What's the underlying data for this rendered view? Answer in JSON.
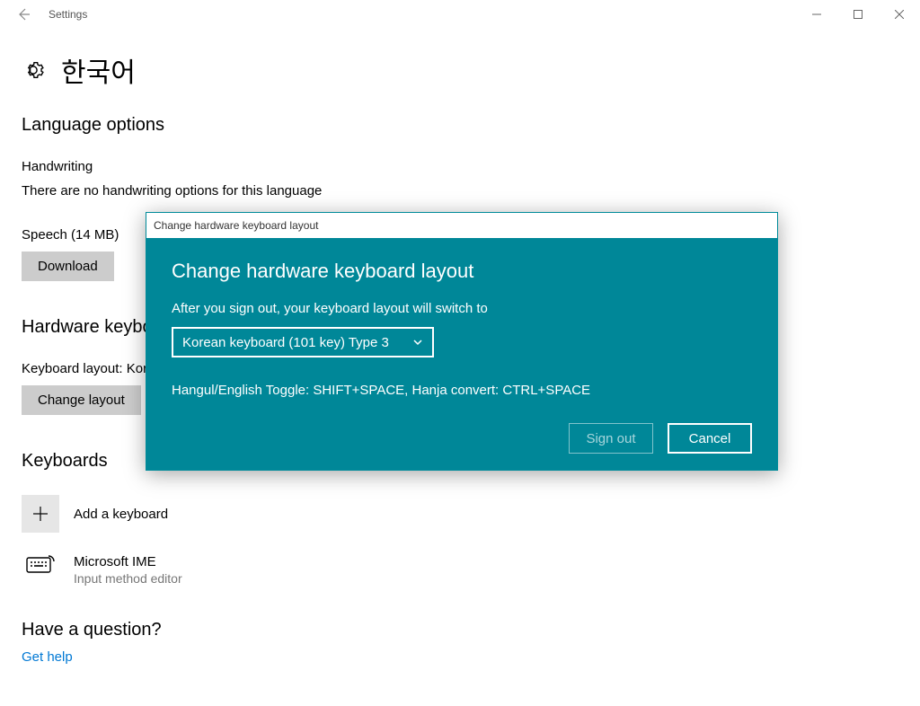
{
  "window": {
    "title": "Settings"
  },
  "header": {
    "page_title": "한국어"
  },
  "sections": {
    "language_options_title": "Language options",
    "handwriting_label": "Handwriting",
    "handwriting_msg": "There are no handwriting options for this language",
    "speech_label": "Speech (14 MB)",
    "download_label": "Download",
    "hardware_title": "Hardware keyboard layout",
    "layout_label": "Keyboard layout:  Korean",
    "change_layout_label": "Change layout",
    "keyboards_title": "Keyboards",
    "add_keyboard_label": "Add a keyboard",
    "ime_name": "Microsoft IME",
    "ime_sub": "Input method editor",
    "help_title": "Have a question?",
    "get_help_link": "Get help"
  },
  "modal": {
    "titlebar": "Change hardware keyboard layout",
    "heading": "Change hardware keyboard layout",
    "lead": "After you sign out, your keyboard layout will switch to",
    "selected": "Korean keyboard (101 key) Type 3",
    "hint": "Hangul/English Toggle: SHIFT+SPACE, Hanja convert: CTRL+SPACE",
    "sign_out": "Sign out",
    "cancel": "Cancel"
  }
}
